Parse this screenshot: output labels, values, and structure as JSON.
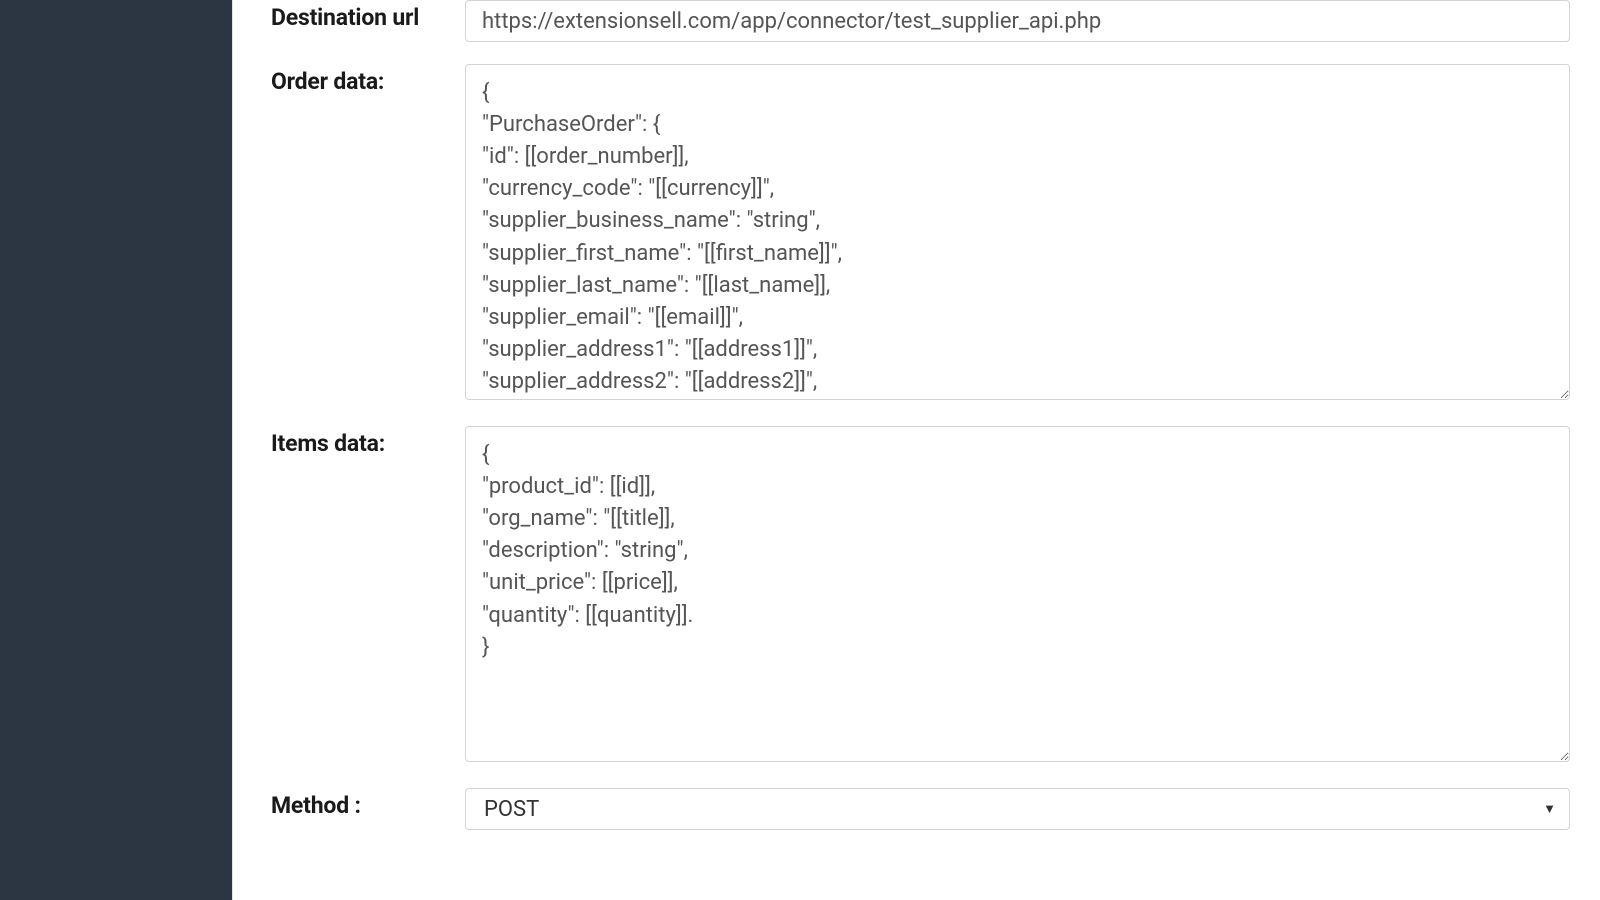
{
  "form": {
    "destination_url": {
      "label": "Destination url",
      "value": "https://extensionsell.com/app/connector/test_supplier_api.php"
    },
    "order_data": {
      "label": "Order data:",
      "value": "{\n\"PurchaseOrder\": {\n\"id\": [[order_number]],\n\"currency_code\": \"[[currency]]\",\n\"supplier_business_name\": \"string\",\n\"supplier_first_name\": \"[[first_name]]\",\n\"supplier_last_name\": \"[[last_name]],\n\"supplier_email\": \"[[email]]\",\n\"supplier_address1\": \"[[address1]]\",\n\"supplier_address2\": \"[[address2]]\","
    },
    "items_data": {
      "label": "Items data:",
      "value": "{\n\"product_id\": [[id]],\n\"org_name\": \"[[title]],\n\"description\": \"string\",\n\"unit_price\": [[price]],\n\"quantity\": [[quantity]].\n}"
    },
    "method": {
      "label": "Method :",
      "value": "POST"
    }
  }
}
